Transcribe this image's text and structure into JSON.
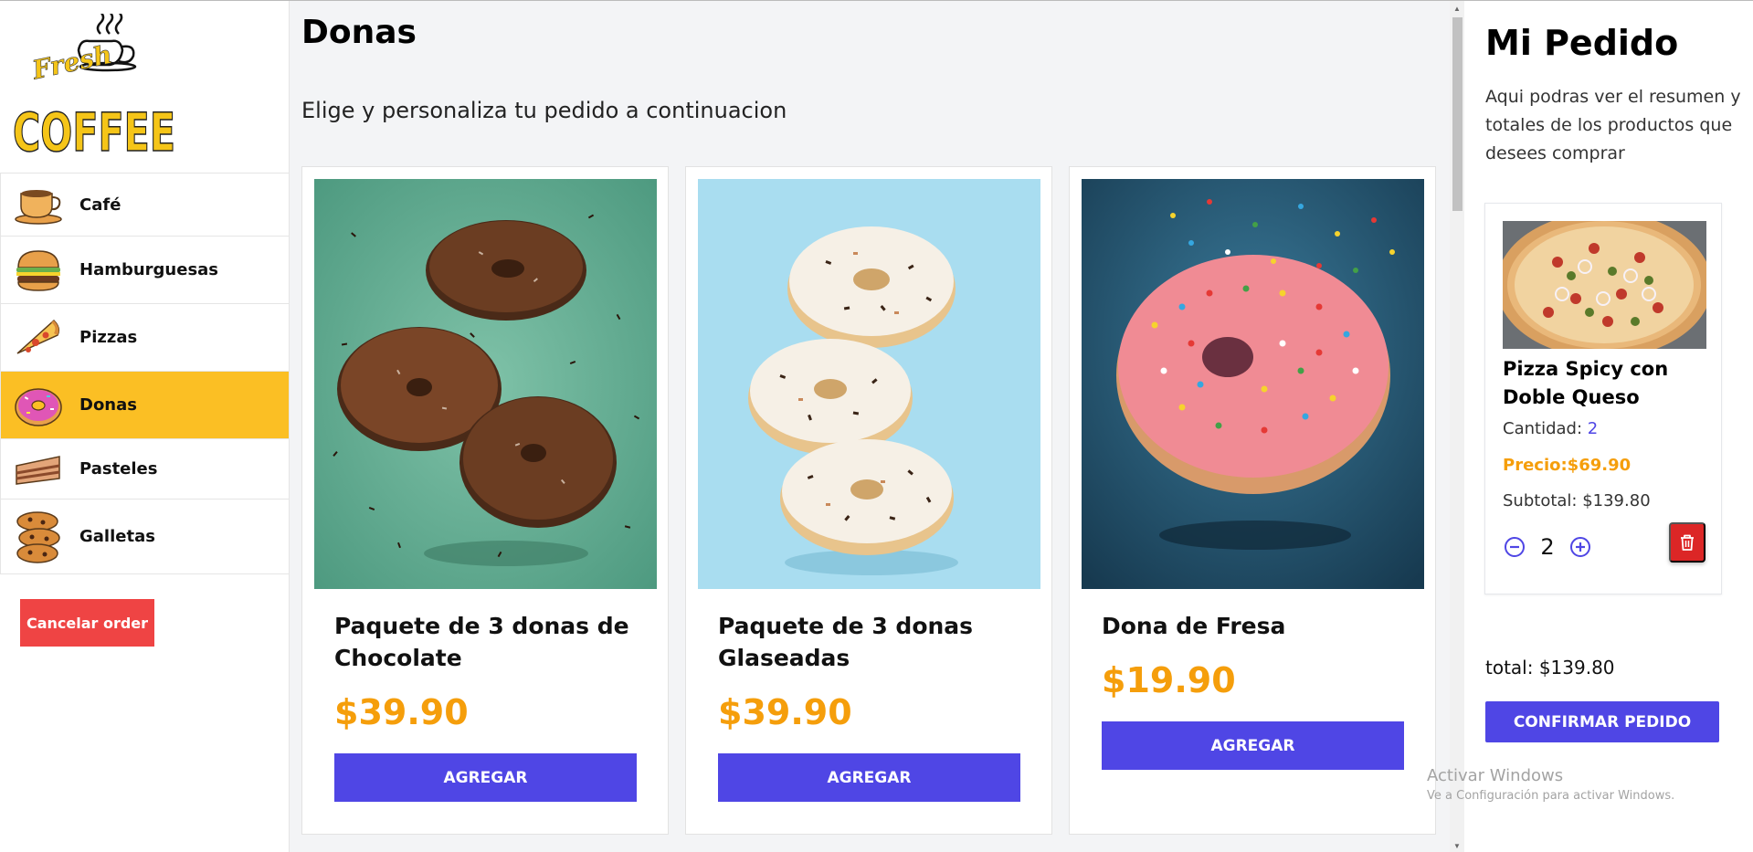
{
  "sidebar": {
    "logo_text_top": "Fresh",
    "logo_text_main": "COFFEE",
    "categories": [
      {
        "label": "Café",
        "icon": "coffee-cup-icon"
      },
      {
        "label": "Hamburguesas",
        "icon": "burger-icon"
      },
      {
        "label": "Pizzas",
        "icon": "pizza-slice-icon"
      },
      {
        "label": "Donas",
        "icon": "donut-icon",
        "active": true
      },
      {
        "label": "Pasteles",
        "icon": "cake-slice-icon"
      },
      {
        "label": "Galletas",
        "icon": "cookies-icon"
      }
    ],
    "cancel_label": "Cancelar order"
  },
  "main": {
    "title": "Donas",
    "subtitle": "Elige y personaliza tu pedido a continuacion",
    "products": [
      {
        "name": "Paquete de 3 donas de Chocolate",
        "price": "$39.90",
        "button": "AGREGAR"
      },
      {
        "name": "Paquete de 3 donas Glaseadas",
        "price": "$39.90",
        "button": "AGREGAR"
      },
      {
        "name": "Dona de Fresa",
        "price": "$19.90",
        "button": "AGREGAR"
      }
    ]
  },
  "order": {
    "title": "Mi Pedido",
    "description": "Aqui podras ver el resumen y totales de los productos que desees comprar",
    "items": [
      {
        "name": "Pizza Spicy con Doble Queso",
        "quantity_label": "Cantidad: ",
        "quantity": "2",
        "price_label": "Precio:$69.90",
        "subtotal_label": "Subtotal: $139.80",
        "stepper_value": "2"
      }
    ],
    "total_label": "total: $139.80",
    "confirm_label": "CONFIRMAR PEDIDO"
  },
  "watermark": {
    "line1": "Activar Windows",
    "line2": "Ve a Configuración para activar Windows."
  },
  "colors": {
    "accent": "#4f46e5",
    "active_category": "#fbbf24",
    "price": "#f59e0b",
    "cancel": "#ef4444",
    "delete": "#dc2626"
  }
}
